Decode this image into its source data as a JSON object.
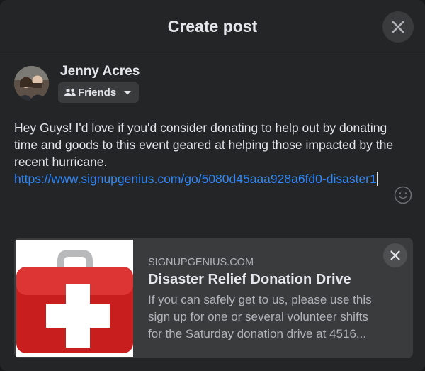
{
  "dialog": {
    "title": "Create post",
    "close_icon": "close-icon"
  },
  "author": {
    "name": "Jenny Acres",
    "audience": "Friends",
    "audience_icon": "friends-icon",
    "caret_icon": "caret-down-icon"
  },
  "composer": {
    "text": "Hey Guys! I'd love if  you'd consider donating to help out by donating time and goods to this event geared at helping those impacted by the recent hurricane.",
    "link": "https://www.signupgenius.com/go/5080d45aaa928a6fd0-disaster1",
    "emoji_icon": "emoji-icon"
  },
  "link_preview": {
    "domain": "SIGNUPGENIUS.COM",
    "title": "Disaster Relief Donation Drive",
    "description_line1": "If you can safely get to us, please use this",
    "description_line2": "sign up for one or several volunteer shifts",
    "description_line3": "for the Saturday donation drive at 4516...",
    "image_icon": "first-aid-kit-icon",
    "close_icon": "close-icon"
  },
  "colors": {
    "background": "#242526",
    "text": "#e4e6eb",
    "secondary_text": "#b0b3b8",
    "link": "#2d88ff",
    "surface": "#3a3b3c"
  }
}
